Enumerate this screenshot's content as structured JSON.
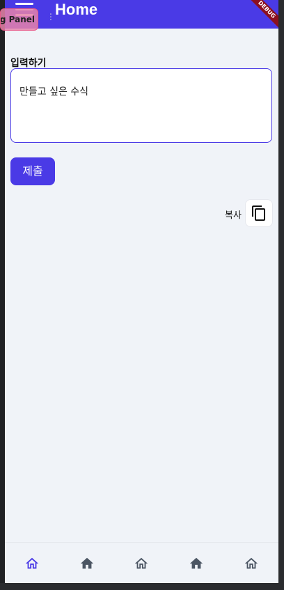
{
  "app": {
    "title": "Home",
    "debug_banner": "DEBUG",
    "debug_panel_label": "Debug Panel",
    "accent_color": "#4a3ae6"
  },
  "form": {
    "label": "입력하기",
    "input_placeholder": "만들고 싶은 수식",
    "submit_label": "제출"
  },
  "result": {
    "copy_label": "복사",
    "copy_icon": "copy-icon"
  },
  "bottom_nav": {
    "items": [
      {
        "icon": "home-outlined-icon",
        "active": true
      },
      {
        "icon": "home-filled-icon",
        "active": false
      },
      {
        "icon": "home-outlined-icon",
        "active": false
      },
      {
        "icon": "home-filled-icon",
        "active": false
      },
      {
        "icon": "home-outlined-icon",
        "active": false
      }
    ]
  }
}
